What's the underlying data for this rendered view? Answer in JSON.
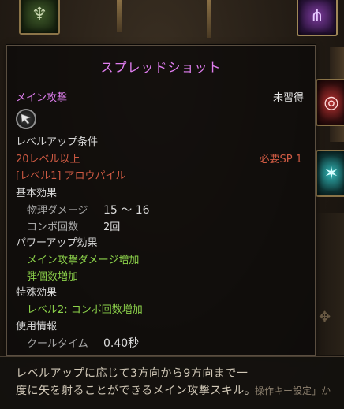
{
  "tooltip": {
    "title": "スプレッドショット",
    "skill_type": "メイン攻撃",
    "learn_state": "未習得",
    "skill_icon": "arrow-cursor-icon",
    "condition_header": "レベルアップ条件",
    "condition_level": "20レベル以上",
    "sp_required": "必要SP 1",
    "prerequisite": "[レベル1] アロウパイル",
    "basic_header": "基本効果",
    "basic": {
      "damage_label": "物理ダメージ",
      "damage_value": "15 〜 16",
      "combo_label": "コンボ回数",
      "combo_value": "2回"
    },
    "powerup_header": "パワーアップ効果",
    "powerups": [
      "メイン攻撃ダメージ増加",
      "弾個数増加"
    ],
    "special_header": "特殊効果",
    "special": "レベル2: コンボ回数増加",
    "usage_header": "使用情報",
    "cooldown_label": "クールタイム",
    "cooldown_value": "0.40秒"
  },
  "description": {
    "line1": "レベルアップに応じて3方向から9方向まで一",
    "line2": "度に矢を射ることができるメイン攻撃スキル。",
    "clipped_bg_text": "操作キー設定」か"
  },
  "colors": {
    "title": "#e07ef0",
    "requirement": "#cf5a43",
    "effect": "#8cd24a",
    "muted": "#a8a8a8"
  }
}
